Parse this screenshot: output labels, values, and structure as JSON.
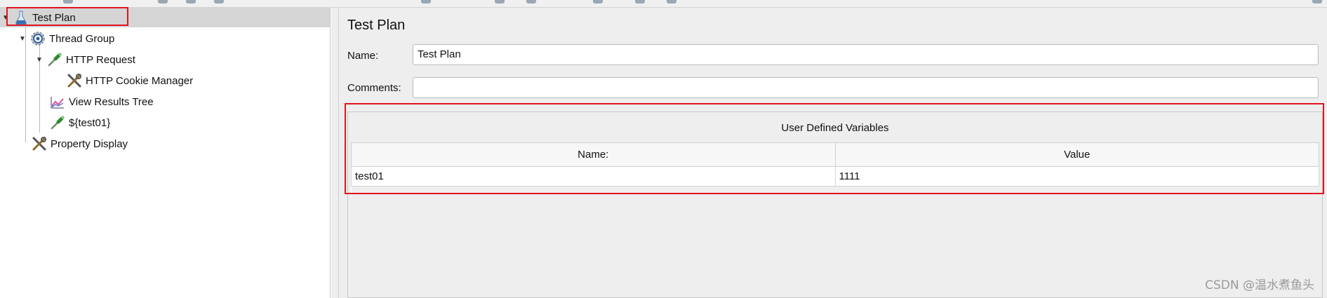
{
  "tree": {
    "items": [
      {
        "label": "Test Plan",
        "icon": "test-plan-icon"
      },
      {
        "label": "Thread Group",
        "icon": "gear-icon"
      },
      {
        "label": "HTTP Request",
        "icon": "pipette-sampler-icon"
      },
      {
        "label": "HTTP Cookie Manager",
        "icon": "wrench-icon"
      },
      {
        "label": "View Results Tree",
        "icon": "chart-listener-icon"
      },
      {
        "label": "${test01}",
        "icon": "pipette-sampler-icon"
      },
      {
        "label": "Property Display",
        "icon": "wrench-icon"
      }
    ]
  },
  "panel": {
    "title": "Test Plan",
    "name_label": "Name:",
    "name_value": "Test Plan",
    "comments_label": "Comments:",
    "comments_value": ""
  },
  "variables": {
    "title": "User Defined Variables",
    "columns": [
      "Name:",
      "Value"
    ],
    "rows": [
      {
        "name": "test01",
        "value": "1111"
      }
    ]
  },
  "watermark": "CSDN @温水煮鱼头",
  "colors": {
    "highlight": "#e0141e",
    "selection": "#d5d5d5",
    "panel_bg": "#eeeeee"
  }
}
